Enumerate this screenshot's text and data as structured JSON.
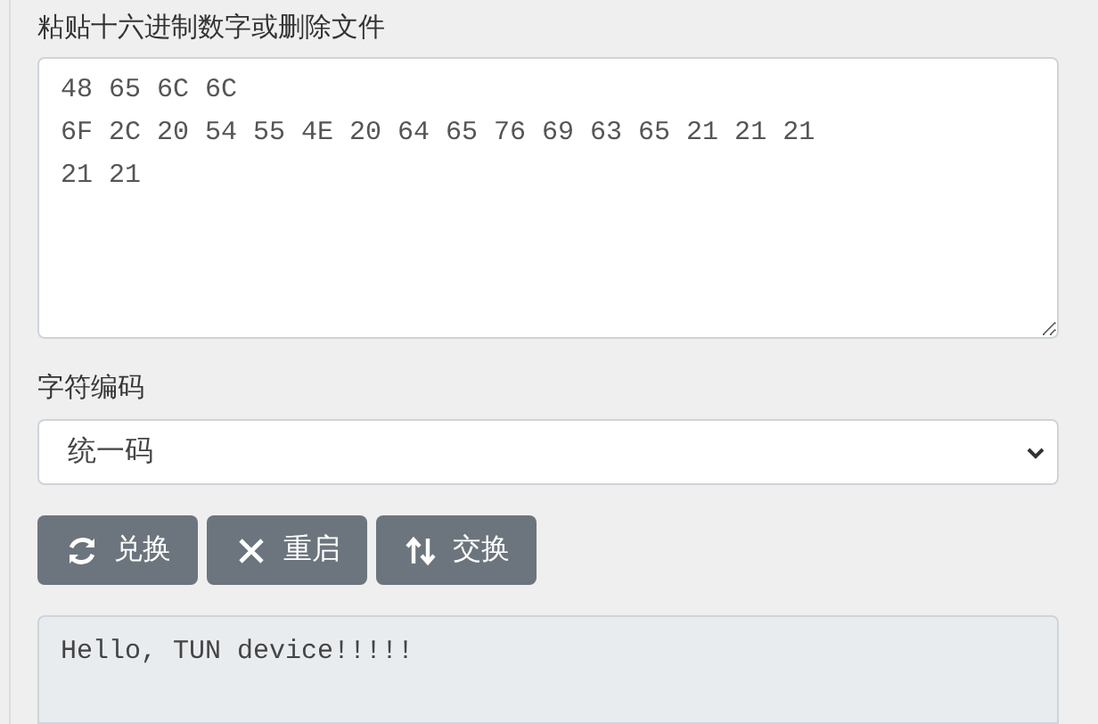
{
  "hex_input": {
    "label": "粘贴十六进制数字或删除文件",
    "value": "48 65 6C 6C\n6F 2C 20 54 55 4E 20 64 65 76 69 63 65 21 21 21\n21 21"
  },
  "encoding": {
    "label": "字符编码",
    "value": "统一码"
  },
  "buttons": [
    {
      "kind": "convert",
      "label": "兑换"
    },
    {
      "kind": "reset",
      "label": "重启"
    },
    {
      "kind": "swap",
      "label": "交换"
    }
  ],
  "output": {
    "value": "Hello, TUN device!!!!!"
  }
}
